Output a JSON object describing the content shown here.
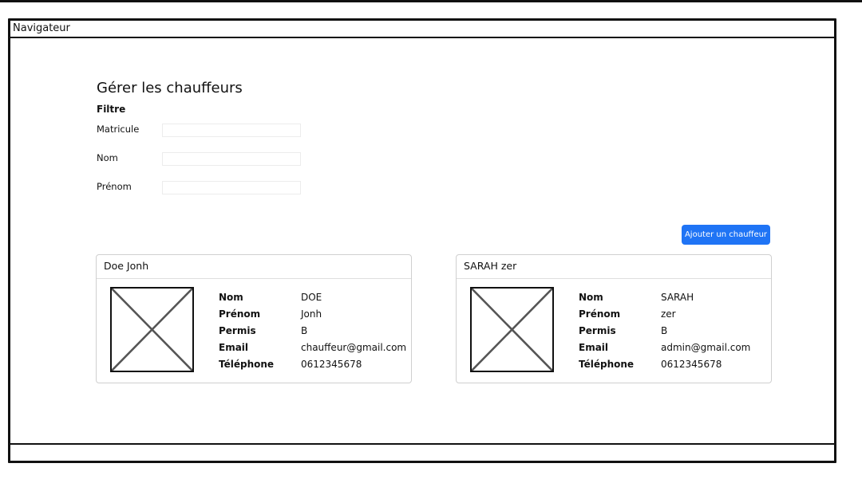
{
  "navbar": {
    "title": "Navigateur"
  },
  "page": {
    "title": "Gérer les chauffeurs"
  },
  "filter": {
    "title": "Filtre",
    "fields": [
      {
        "label": "Matricule",
        "value": ""
      },
      {
        "label": "Nom",
        "value": ""
      },
      {
        "label": "Prénom",
        "value": ""
      }
    ]
  },
  "actions": {
    "add_label": "Ajouter un chauffeur"
  },
  "colors": {
    "accent": "#1f74f5"
  },
  "info_labels": {
    "nom": "Nom",
    "prenom": "Prénom",
    "permis": "Permis",
    "email": "Email",
    "telephone": "Téléphone"
  },
  "drivers": [
    {
      "header": "Doe Jonh",
      "nom": "DOE",
      "prenom": "Jonh",
      "permis": "B",
      "email": "chauffeur@gmail.com",
      "telephone": "0612345678"
    },
    {
      "header": "SARAH zer",
      "nom": "SARAH",
      "prenom": "zer",
      "permis": "B",
      "email": "admin@gmail.com",
      "telephone": "0612345678"
    }
  ]
}
